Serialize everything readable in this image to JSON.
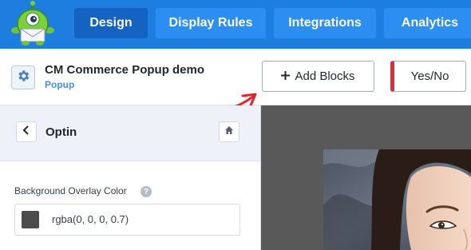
{
  "nav": {
    "tabs": [
      {
        "label": "Design",
        "active": true
      },
      {
        "label": "Display Rules",
        "active": false
      },
      {
        "label": "Integrations",
        "active": false
      },
      {
        "label": "Analytics",
        "active": false
      }
    ]
  },
  "campaign": {
    "title": "CM Commerce Popup demo",
    "type": "Popup",
    "settings_icon": "gear-icon"
  },
  "toolbar": {
    "add_blocks_label": "Add Blocks",
    "add_blocks_icon": "plus-icon",
    "yesno_label": "Yes/No"
  },
  "panel": {
    "title": "Optin",
    "back_icon": "chevron-left-icon",
    "home_icon": "home-icon",
    "field_label": "Background Overlay Color",
    "help_icon": "question-icon",
    "color_value": "rgba(0, 0, 0, 0.7)",
    "swatch_color": "#4c4c4c"
  },
  "colors": {
    "nav_bg": "#1e7ee0",
    "tab_bg": "#2b8ef0",
    "tab_active_bg": "#1462c2",
    "accent_red": "#d6323c",
    "preview_bg": "#595959"
  }
}
